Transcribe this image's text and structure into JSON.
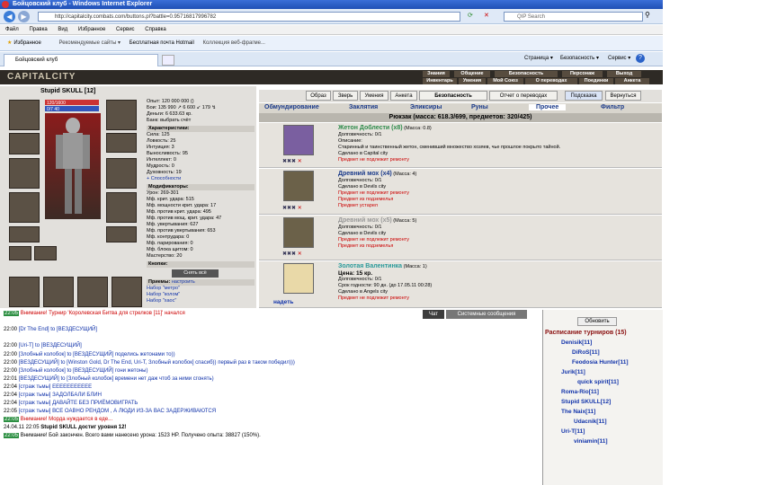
{
  "window": {
    "title": "Бойцовский клуб - Windows Internet Explorer"
  },
  "browser": {
    "address": "http://capitalcity.combats.com/buttons.pl?battle=0.95716817996782",
    "search_placeholder": "QIP Search",
    "menu": [
      "Файл",
      "Правка",
      "Вид",
      "Избранное",
      "Сервис",
      "Справка"
    ],
    "favorites": [
      "Избранное",
      "Рекомендуемые сайты ▾",
      "Бесплатная почта Hotmail",
      "Коллекция веб-фрагме..."
    ],
    "tab": "Бойцовский клуб",
    "tools": [
      "Страница ▾",
      "Безопасность ▾",
      "Сервис ▾"
    ]
  },
  "game": {
    "logo": "CAPITALCITY",
    "toplinks": [
      [
        "Знания",
        "Общение",
        "Безопасность",
        "Персонаж",
        "Выход"
      ],
      [
        "Инвентарь",
        "Умения",
        "Мой Союз",
        "О переводах",
        "Поединки",
        "Анкета"
      ]
    ],
    "char_name": "Stupid SKULL [12]",
    "hp": "120/1600",
    "mp": "0/7 40",
    "stats_top": [
      "Опыт: 120 000 000 ()",
      "Бои: 135 990 ↗ 6 600 ↙ 179 ↯",
      "Деньги: 6 633.63 кр.",
      "Банк: выбрать счёт"
    ],
    "sections": [
      {
        "title": "Характеристики:",
        "lines": [
          "Сила: 125",
          "Ловкость: 25",
          "Интуиция: 3",
          "Выносливость: 95",
          "Интеллект: 0",
          "Мудрость: 0",
          "Духовность: 19",
          "+ Способности"
        ]
      },
      {
        "title": "Модификаторы:",
        "lines": [
          "Урон: 269-301",
          "Мф. крит. удара: 515",
          "Мф. мощности крит. удара: 17",
          "Мф. против крит. удара: 495",
          "Мф. против мощ. крит. удара: 47",
          "Мф. увертывания: 627",
          "Мф. против увертывания: 653",
          "Мф. контрудара: 0",
          "Мф. парирования: 0",
          "Мф. блока щитом: 0",
          "Мастерство: 20"
        ]
      },
      {
        "title": "Кнопки:",
        "lines": []
      },
      {
        "title": "Приемы:",
        "lines": [
          "Набор \"метро\"",
          "Набор \"колом\"",
          "Набор \"хаос\""
        ]
      }
    ],
    "remove_all": "Снять всё",
    "setup": "настроить",
    "nav_buttons": [
      "Образ",
      "Зверь",
      "Умения",
      "Анкета",
      "Безопасность",
      "Отчет о переводах",
      "Подсказка",
      "Вернуться"
    ],
    "inv_tabs": [
      "Обмундирование",
      "Заклятия",
      "Эликсиры",
      "Руны",
      "Прочее",
      "Фильтр"
    ],
    "backpack": "Рюкзак (масса: 618.3/699, предметов: 320/425)",
    "items": [
      {
        "name": "Жетон Доблести (x8)",
        "mass": "(Масса: 0.8)",
        "lines": [
          "Долговечность: 0/1",
          "Описание:",
          "Старинный и таинственный жетон, сменивший множество хозяев, чье прошлое покрыто тайной.",
          "Сделано в Capital city"
        ],
        "red": [
          "Предмет не подлежит ремонту"
        ]
      },
      {
        "name": "Древний мох (x4)",
        "mass": "(Масса: 4)",
        "lines": [
          "Долговечность: 0/1",
          "Сделано в Devils city"
        ],
        "red": [
          "Предмет не подлежит ремонту",
          "Предмет из подземелья",
          "Предмет устарел"
        ]
      },
      {
        "name": "Древний мох (x5)",
        "mass": "(Масса: 5)",
        "lines": [
          "Долговечность: 0/1",
          "Сделано в Devils city"
        ],
        "red": [
          "Предмет не подлежит ремонту",
          "Предмет из подземелья"
        ]
      },
      {
        "name": "Золотая Валентинка",
        "mass": "(Масса: 1)",
        "lines": [
          "Цена: 15 кр.",
          "Долговечность: 0/1",
          "Срок годности: 90 дн. (до 17.05.11 00:28)",
          "Сделано в Angels city"
        ],
        "red": [
          "Предмет не подлежит ремонту"
        ],
        "action": "надеть"
      }
    ]
  },
  "chat": {
    "tabs": [
      "Чат",
      "Системные сообщения"
    ],
    "lines": [
      {
        "time": "22:05",
        "text": "Внимание! Турнир 'Королевская Битва для стрелков [11]' начался"
      },
      {
        "time": "22:00",
        "text": "[Dr The End] to [ВЕЗДЕСУЩИЙ]"
      },
      {
        "time": "22:00",
        "text": "[Uri-T] to [ВЕЗДЕСУЩИЙ]"
      },
      {
        "time": "22:00",
        "text": "[Злобный колобок] to [ВЕЗДЕСУЩИЙ] поделись жетонами то))"
      },
      {
        "time": "22:00",
        "text": "[ВЕЗДЕСУЩИЙ] to [Winston Gold, Dr The End, Uri-T, Злобный колобок] спасиб)) первый раз в таком победил)))"
      },
      {
        "time": "22:00",
        "text": "[Злобный колобок] to [ВЕЗДЕСУЩИЙ] гони жетоны)"
      },
      {
        "time": "22:01",
        "text": "[ВЕЗДЕСУЩИЙ] to [Злобный колобок] времени нет даж чтоб за ними сгонять)"
      },
      {
        "time": "22:04",
        "text": "[страж тьмы] ЕЕЕЕЕЕЕЕЕЕЕ"
      },
      {
        "time": "22:04",
        "text": "[страж тьмы] ЗАДОЛБАЛИ БЛИН"
      },
      {
        "time": "22:04",
        "text": "[страж тьмы] ДАВАЙТЕ БЕЗ ПРИЁМОВИГРАТЬ"
      },
      {
        "time": "22:05",
        "text": "[страж тьмы] ВСЕ ОАВНО РЕНДОМ , А ЛЮДИ ИЗ-ЗА ВАС ЗАДЕРЖИВАЮТСЯ"
      },
      {
        "time": "22:05",
        "text": "Внимание! Морда нуждается в еде..."
      },
      {
        "time": "24.04.11 22:05",
        "text": "Stupid SKULL достиг уровня 12!"
      },
      {
        "time": "22:05",
        "text": "Внимание! Бой закончен. Всего вами нанесено урона: 1523 HP. Получено опыта: 38827 (150%)."
      }
    ]
  },
  "tournaments": {
    "refresh": "Обновить",
    "title": "Расписание турниров (15)",
    "players": [
      "Denisik[11]",
      "DiRoS[11]",
      "Feodosia Hunter[11]",
      "Jurik[11]",
      "quick spirit[11]",
      "Roma-Rio[11]",
      "Stupid SKULL[12]",
      "The Naix[11]",
      "Udacnik[11]",
      "Uri-T[11]",
      "viniamin[11]"
    ]
  }
}
